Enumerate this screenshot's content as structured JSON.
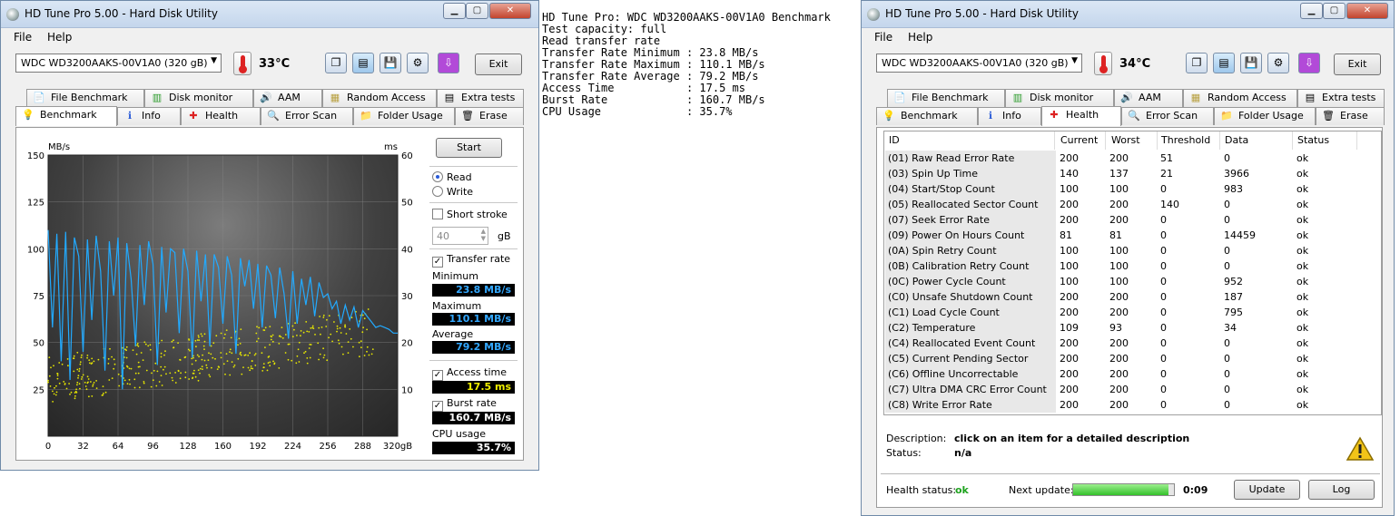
{
  "left_window": {
    "title": "HD Tune Pro 5.00 - Hard Disk Utility",
    "menu": [
      "File",
      "Help"
    ],
    "drive": "WDC WD3200AAKS-00V1A0 (320 gB)",
    "temperature": "33°C",
    "exit_label": "Exit",
    "tabs_top": [
      "File Benchmark",
      "Disk monitor",
      "AAM",
      "Random Access",
      "Extra tests"
    ],
    "tabs_bottom": [
      "Benchmark",
      "Info",
      "Health",
      "Error Scan",
      "Folder Usage",
      "Erase"
    ],
    "start_label": "Start",
    "read_label": "Read",
    "write_label": "Write",
    "short_stroke_label": "Short stroke",
    "short_stroke_value": "40",
    "gb_unit": "gB",
    "transfer_rate_label": "Transfer rate",
    "minimum_label": "Minimum",
    "minimum_value": "23.8 MB/s",
    "maximum_label": "Maximum",
    "maximum_value": "110.1 MB/s",
    "average_label": "Average",
    "average_value": "79.2 MB/s",
    "access_time_label": "Access time",
    "access_time_value": "17.5 ms",
    "burst_rate_label": "Burst rate",
    "burst_rate_value": "160.7 MB/s",
    "cpu_usage_label": "CPU usage",
    "cpu_usage_value": "35.7%"
  },
  "chart_data": {
    "type": "line",
    "y_left_label": "MB/s",
    "y_right_label": "ms",
    "x_ticks": [
      "0",
      "32",
      "64",
      "96",
      "128",
      "160",
      "192",
      "224",
      "256",
      "288",
      "320gB"
    ],
    "y_left_ticks": [
      "150",
      "125",
      "100",
      "75",
      "50",
      "25"
    ],
    "y_right_ticks": [
      "60",
      "50",
      "40",
      "30",
      "20",
      "10"
    ],
    "ylim_left": [
      0,
      150
    ],
    "ylim_right": [
      0,
      60
    ],
    "xlim": [
      0,
      320
    ],
    "grid": true,
    "series": [
      {
        "color": "#22aaff",
        "x": [
          0,
          4,
          8,
          12,
          16,
          20,
          24,
          28,
          32,
          36,
          40,
          44,
          48,
          52,
          56,
          60,
          64,
          68,
          72,
          76,
          80,
          84,
          88,
          92,
          96,
          100,
          104,
          108,
          112,
          116,
          120,
          124,
          128,
          132,
          136,
          140,
          144,
          148,
          152,
          156,
          160,
          164,
          168,
          172,
          176,
          180,
          184,
          188,
          192,
          196,
          200,
          204,
          208,
          212,
          216,
          220,
          224,
          228,
          232,
          236,
          240,
          244,
          248,
          252,
          256,
          260,
          264,
          268,
          272,
          276,
          280,
          284,
          288,
          292,
          296,
          300,
          304,
          308,
          312,
          316,
          320
        ],
        "y": [
          110,
          58,
          108,
          40,
          109,
          30,
          106,
          96,
          45,
          105,
          62,
          107,
          88,
          35,
          104,
          75,
          106,
          25,
          103,
          84,
          48,
          102,
          70,
          104,
          92,
          38,
          101,
          66,
          100,
          98,
          55,
          100,
          88,
          42,
          99,
          72,
          97,
          48,
          97,
          90,
          60,
          96,
          86,
          44,
          95,
          80,
          94,
          68,
          92,
          58,
          91,
          86,
          63,
          90,
          76,
          52,
          88,
          60,
          84,
          70,
          85,
          64,
          82,
          74,
          76,
          68,
          72,
          60,
          70,
          62,
          69,
          58,
          67,
          64,
          61,
          58,
          59,
          58,
          57,
          55,
          55
        ]
      },
      {
        "color": "#e8e800",
        "type": "scatter",
        "note": "access time"
      }
    ]
  },
  "console": {
    "lines": [
      "HD Tune Pro: WDC WD3200AAKS-00V1A0 Benchmark",
      "",
      "Test capacity: full",
      "",
      "Read transfer rate",
      "Transfer Rate Minimum : 23.8 MB/s",
      "Transfer Rate Maximum : 110.1 MB/s",
      "Transfer Rate Average : 79.2 MB/s",
      "Access Time           : 17.5 ms",
      "Burst Rate            : 160.7 MB/s",
      "CPU Usage             : 35.7%"
    ]
  },
  "right_window": {
    "title": "HD Tune Pro 5.00 - Hard Disk Utility",
    "menu": [
      "File",
      "Help"
    ],
    "drive": "WDC WD3200AAKS-00V1A0 (320 gB)",
    "temperature": "34°C",
    "exit_label": "Exit",
    "tabs_top": [
      "File Benchmark",
      "Disk monitor",
      "AAM",
      "Random Access",
      "Extra tests"
    ],
    "tabs_bottom": [
      "Benchmark",
      "Info",
      "Health",
      "Error Scan",
      "Folder Usage",
      "Erase"
    ],
    "columns": [
      "ID",
      "Current",
      "Worst",
      "Threshold",
      "Data",
      "Status"
    ],
    "rows": [
      [
        "(01) Raw Read Error Rate",
        "200",
        "200",
        "51",
        "0",
        "ok"
      ],
      [
        "(03) Spin Up Time",
        "140",
        "137",
        "21",
        "3966",
        "ok"
      ],
      [
        "(04) Start/Stop Count",
        "100",
        "100",
        "0",
        "983",
        "ok"
      ],
      [
        "(05) Reallocated Sector Count",
        "200",
        "200",
        "140",
        "0",
        "ok"
      ],
      [
        "(07) Seek Error Rate",
        "200",
        "200",
        "0",
        "0",
        "ok"
      ],
      [
        "(09) Power On Hours Count",
        "81",
        "81",
        "0",
        "14459",
        "ok"
      ],
      [
        "(0A) Spin Retry Count",
        "100",
        "100",
        "0",
        "0",
        "ok"
      ],
      [
        "(0B) Calibration Retry Count",
        "100",
        "100",
        "0",
        "0",
        "ok"
      ],
      [
        "(0C) Power Cycle Count",
        "100",
        "100",
        "0",
        "952",
        "ok"
      ],
      [
        "(C0) Unsafe Shutdown Count",
        "200",
        "200",
        "0",
        "187",
        "ok"
      ],
      [
        "(C1) Load Cycle Count",
        "200",
        "200",
        "0",
        "795",
        "ok"
      ],
      [
        "(C2) Temperature",
        "109",
        "93",
        "0",
        "34",
        "ok"
      ],
      [
        "(C4) Reallocated Event Count",
        "200",
        "200",
        "0",
        "0",
        "ok"
      ],
      [
        "(C5) Current Pending Sector",
        "200",
        "200",
        "0",
        "0",
        "ok"
      ],
      [
        "(C6) Offline Uncorrectable",
        "200",
        "200",
        "0",
        "0",
        "ok"
      ],
      [
        "(C7) Ultra DMA CRC Error Count",
        "200",
        "200",
        "0",
        "0",
        "ok"
      ],
      [
        "(C8) Write Error Rate",
        "200",
        "200",
        "0",
        "0",
        "ok"
      ]
    ],
    "description_label": "Description:",
    "description_value": "click on an item for a detailed description",
    "status_label": "Status:",
    "status_value": "n/a",
    "health_status_label": "Health status:",
    "health_status_value": "ok",
    "next_update_label": "Next update:",
    "next_update_progress": 0.95,
    "next_update_time": "0:09",
    "update_label": "Update",
    "log_label": "Log"
  }
}
